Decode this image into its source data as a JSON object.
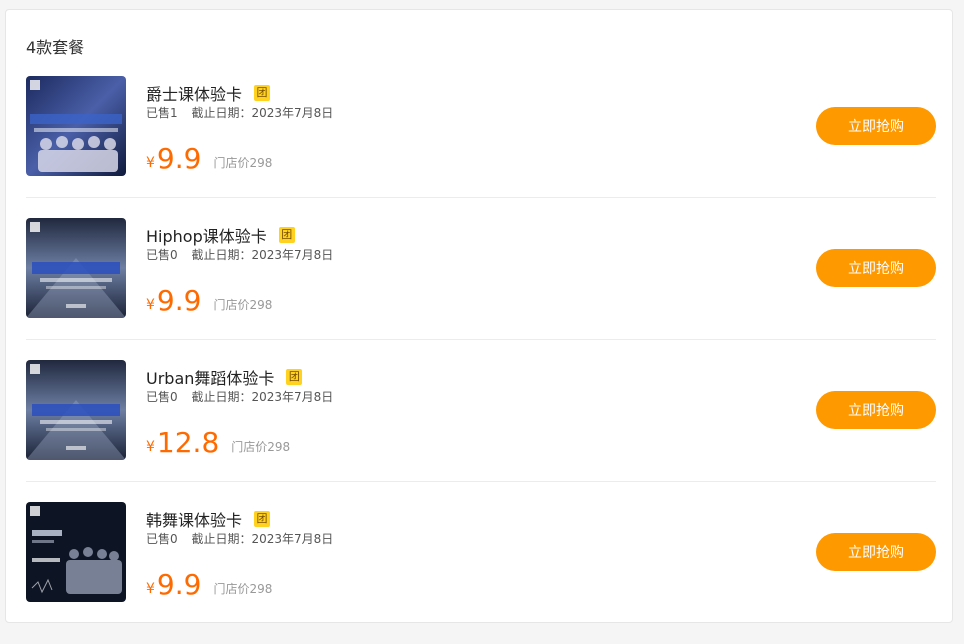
{
  "section": {
    "title": "4款套餐"
  },
  "packages": [
    {
      "name": "爵士课体验卡",
      "badge": "团",
      "sold": "已售1",
      "deadline": "截止日期：2023年7月8日",
      "currency": "¥",
      "price": "9.9",
      "original": "门店价298",
      "button": "立即抢购"
    },
    {
      "name": "Hiphop课体验卡",
      "badge": "团",
      "sold": "已售0",
      "deadline": "截止日期：2023年7月8日",
      "currency": "¥",
      "price": "9.9",
      "original": "门店价298",
      "button": "立即抢购"
    },
    {
      "name": "Urban舞蹈体验卡",
      "badge": "团",
      "sold": "已售0",
      "deadline": "截止日期：2023年7月8日",
      "currency": "¥",
      "price": "12.8",
      "original": "门店价298",
      "button": "立即抢购"
    },
    {
      "name": "韩舞课体验卡",
      "badge": "团",
      "sold": "已售0",
      "deadline": "截止日期：2023年7月8日",
      "currency": "¥",
      "price": "9.9",
      "original": "门店价298",
      "button": "立即抢购"
    }
  ],
  "colors": {
    "accent": "#ff6a00",
    "button": "#ff9900",
    "badge": "#ffd21f"
  }
}
